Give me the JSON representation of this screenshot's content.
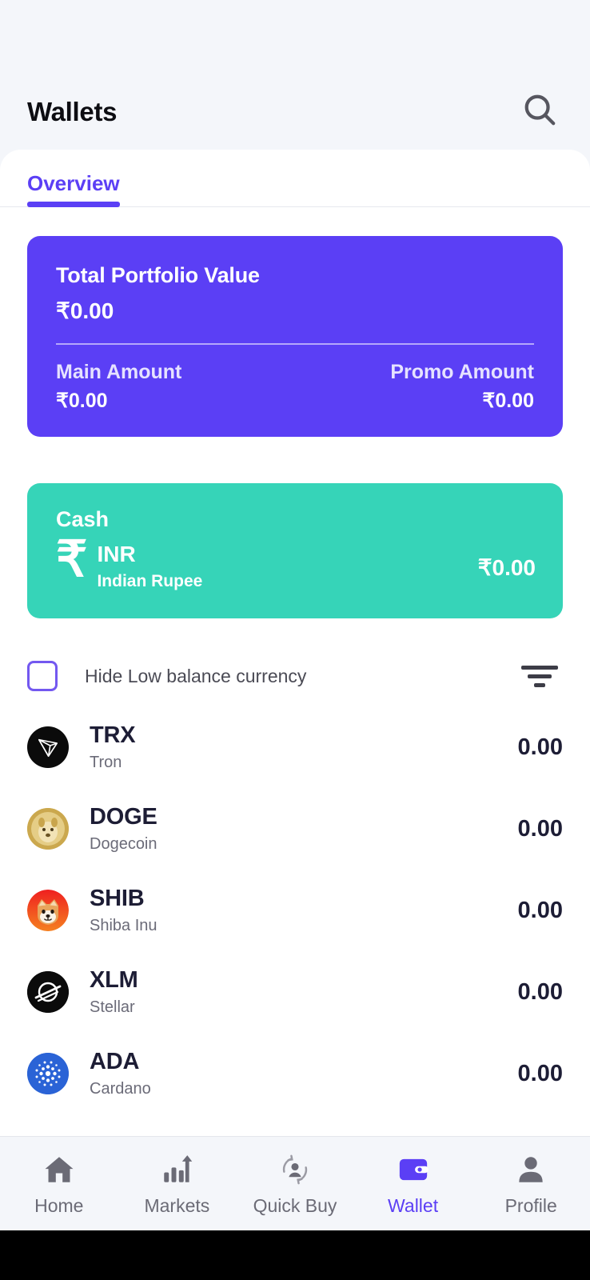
{
  "header": {
    "title": "Wallets",
    "search_icon": "search-icon"
  },
  "tabs": [
    {
      "label": "Overview",
      "active": true
    }
  ],
  "portfolio": {
    "title": "Total Portfolio Value",
    "value": "₹0.00",
    "main_label": "Main Amount",
    "main_value": "₹0.00",
    "promo_label": "Promo Amount",
    "promo_value": "₹0.00"
  },
  "cash": {
    "title": "Cash",
    "currency_icon": "rupee-icon",
    "code": "INR",
    "name": "Indian Rupee",
    "amount": "₹0.00"
  },
  "filter": {
    "checkbox_label": "Hide Low balance currency",
    "checked": false,
    "filter_icon": "filter-icon"
  },
  "coins": [
    {
      "icon": "tron-icon",
      "code": "TRX",
      "name": "Tron",
      "balance": "0.00"
    },
    {
      "icon": "dogecoin-icon",
      "code": "DOGE",
      "name": "Dogecoin",
      "balance": "0.00"
    },
    {
      "icon": "shiba-icon",
      "code": "SHIB",
      "name": "Shiba Inu",
      "balance": "0.00"
    },
    {
      "icon": "stellar-icon",
      "code": "XLM",
      "name": "Stellar",
      "balance": "0.00"
    },
    {
      "icon": "cardano-icon",
      "code": "ADA",
      "name": "Cardano",
      "balance": "0.00"
    }
  ],
  "bottom_nav": [
    {
      "label": "Home",
      "icon": "home-icon",
      "active": false
    },
    {
      "label": "Markets",
      "icon": "chart-up-icon",
      "active": false
    },
    {
      "label": "Quick Buy",
      "icon": "swap-user-icon",
      "active": false
    },
    {
      "label": "Wallet",
      "icon": "wallet-icon",
      "active": true
    },
    {
      "label": "Profile",
      "icon": "person-icon",
      "active": false
    }
  ],
  "colors": {
    "accent": "#5B3FF5",
    "cash_card": "#36D4B8",
    "header_bg": "#F4F6FA",
    "text_dark": "#1d1d35",
    "text_muted": "#6b6b78"
  }
}
